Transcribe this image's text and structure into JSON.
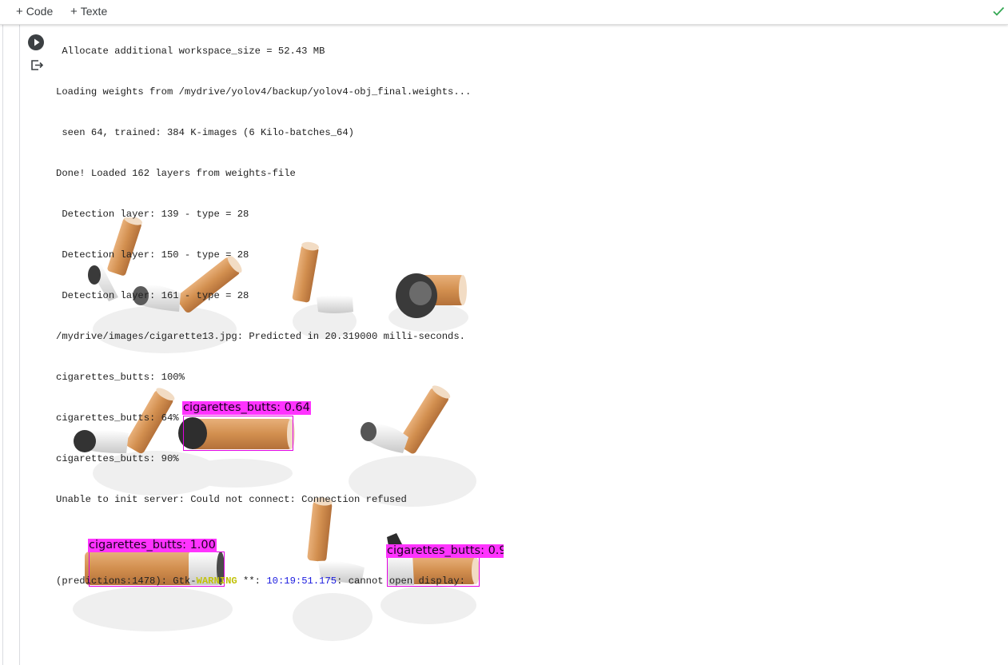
{
  "toolbar": {
    "add_code": "Code",
    "add_text": "Texte",
    "plus": "+"
  },
  "output": {
    "lines": [
      " Allocate additional workspace_size = 52.43 MB",
      "Loading weights from /mydrive/yolov4/backup/yolov4-obj_final.weights...",
      " seen 64, trained: 384 K-images (6 Kilo-batches_64)",
      "Done! Loaded 162 layers from weights-file",
      " Detection layer: 139 - type = 28",
      " Detection layer: 150 - type = 28",
      " Detection layer: 161 - type = 28",
      "/mydrive/images/cigarette13.jpg: Predicted in 20.319000 milli-seconds.",
      "cigarettes_butts: 100%",
      "cigarettes_butts: 64%",
      "cigarettes_butts: 90%",
      "Unable to init server: Could not connect: Connection refused",
      ""
    ],
    "gtk": {
      "prefix": "(predictions:1478): Gtk-",
      "level": "WARNING",
      "sep": " **: ",
      "time": "10:19:51.175",
      "msg": ": cannot open display:"
    }
  },
  "detections": [
    {
      "label": "cigarettes_butts: 0.64"
    },
    {
      "label": "cigarettes_butts: 1.00"
    },
    {
      "label": "cigarettes_butts: 0.9"
    }
  ],
  "colors": {
    "box": "#e000e0",
    "label_bg": "#ff33ff",
    "filter": "#d9955a",
    "ash": "#3a3a3a",
    "check": "#34a853"
  }
}
